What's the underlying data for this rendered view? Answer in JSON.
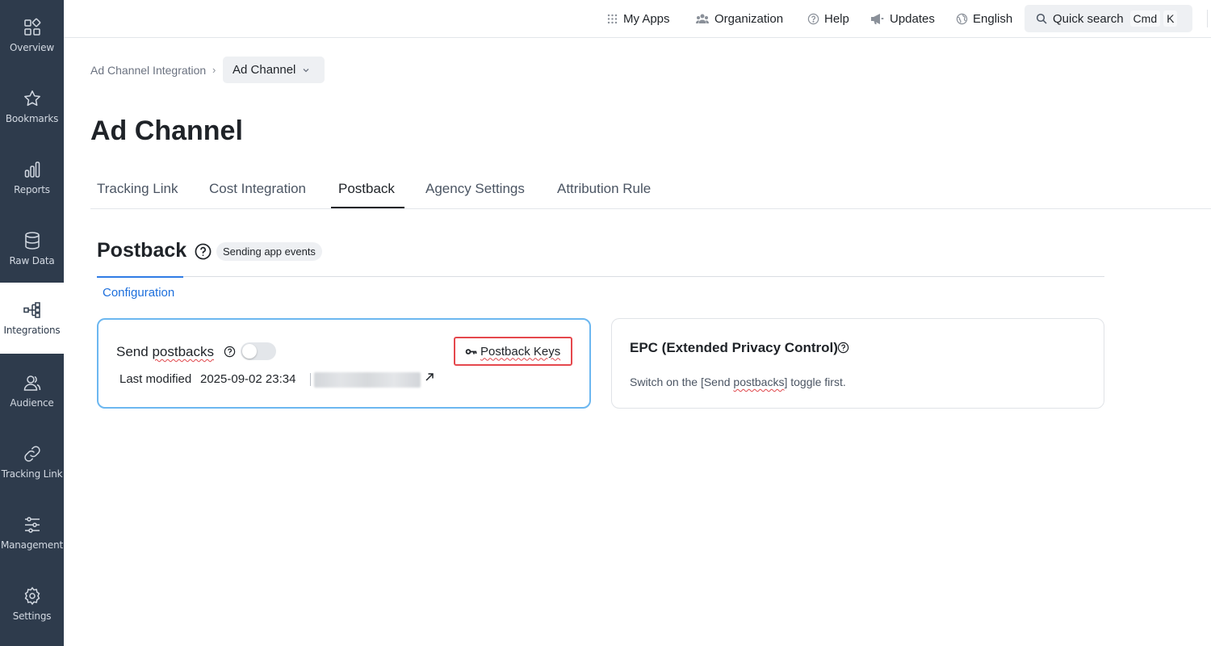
{
  "sidebar": {
    "items": [
      {
        "label": "Overview",
        "icon": "overview-icon"
      },
      {
        "label": "Bookmarks",
        "icon": "star-icon"
      },
      {
        "label": "Reports",
        "icon": "bar-chart-icon"
      },
      {
        "label": "Raw Data",
        "icon": "database-icon"
      },
      {
        "label": "Integrations",
        "icon": "integrations-icon",
        "active": true
      },
      {
        "label": "Audience",
        "icon": "people-icon"
      },
      {
        "label": "Tracking Link",
        "icon": "link-icon"
      },
      {
        "label": "Management",
        "icon": "sliders-icon"
      },
      {
        "label": "Settings",
        "icon": "gear-icon"
      }
    ]
  },
  "topbar": {
    "my_apps": "My Apps",
    "organization": "Organization",
    "help": "Help",
    "updates": "Updates",
    "language": "English",
    "search_label": "Quick search",
    "shortcut_mod": "Cmd",
    "shortcut_key": "K"
  },
  "breadcrumb": {
    "parent": "Ad Channel Integration",
    "separator": "›",
    "current": "Ad Channel"
  },
  "page": {
    "title": "Ad Channel"
  },
  "tabs": [
    {
      "label": "Tracking Link"
    },
    {
      "label": "Cost Integration"
    },
    {
      "label": "Postback",
      "active": true
    },
    {
      "label": "Agency Settings"
    },
    {
      "label": "Attribution Rule"
    }
  ],
  "section": {
    "title": "Postback",
    "badge": "Sending app events",
    "subtab": "Configuration"
  },
  "send_card": {
    "label_prefix": "Send ",
    "label_word": "postbacks",
    "toggle_on": false,
    "keys_button": "Postback Keys",
    "modified_label": "Last modified",
    "modified_value": "2025-09-02 23:34",
    "link_icon": "external-link-icon"
  },
  "epc_card": {
    "title": "EPC (Extended Privacy Control)",
    "desc_prefix": "Switch on the [Send ",
    "desc_word": "postbacks",
    "desc_suffix": "] toggle first."
  },
  "colors": {
    "sidebar_bg": "#2e3b4c",
    "accent_blue": "#1d6fdc",
    "card_focus_border": "#6cb7f0",
    "highlight_red": "#e5484d"
  }
}
